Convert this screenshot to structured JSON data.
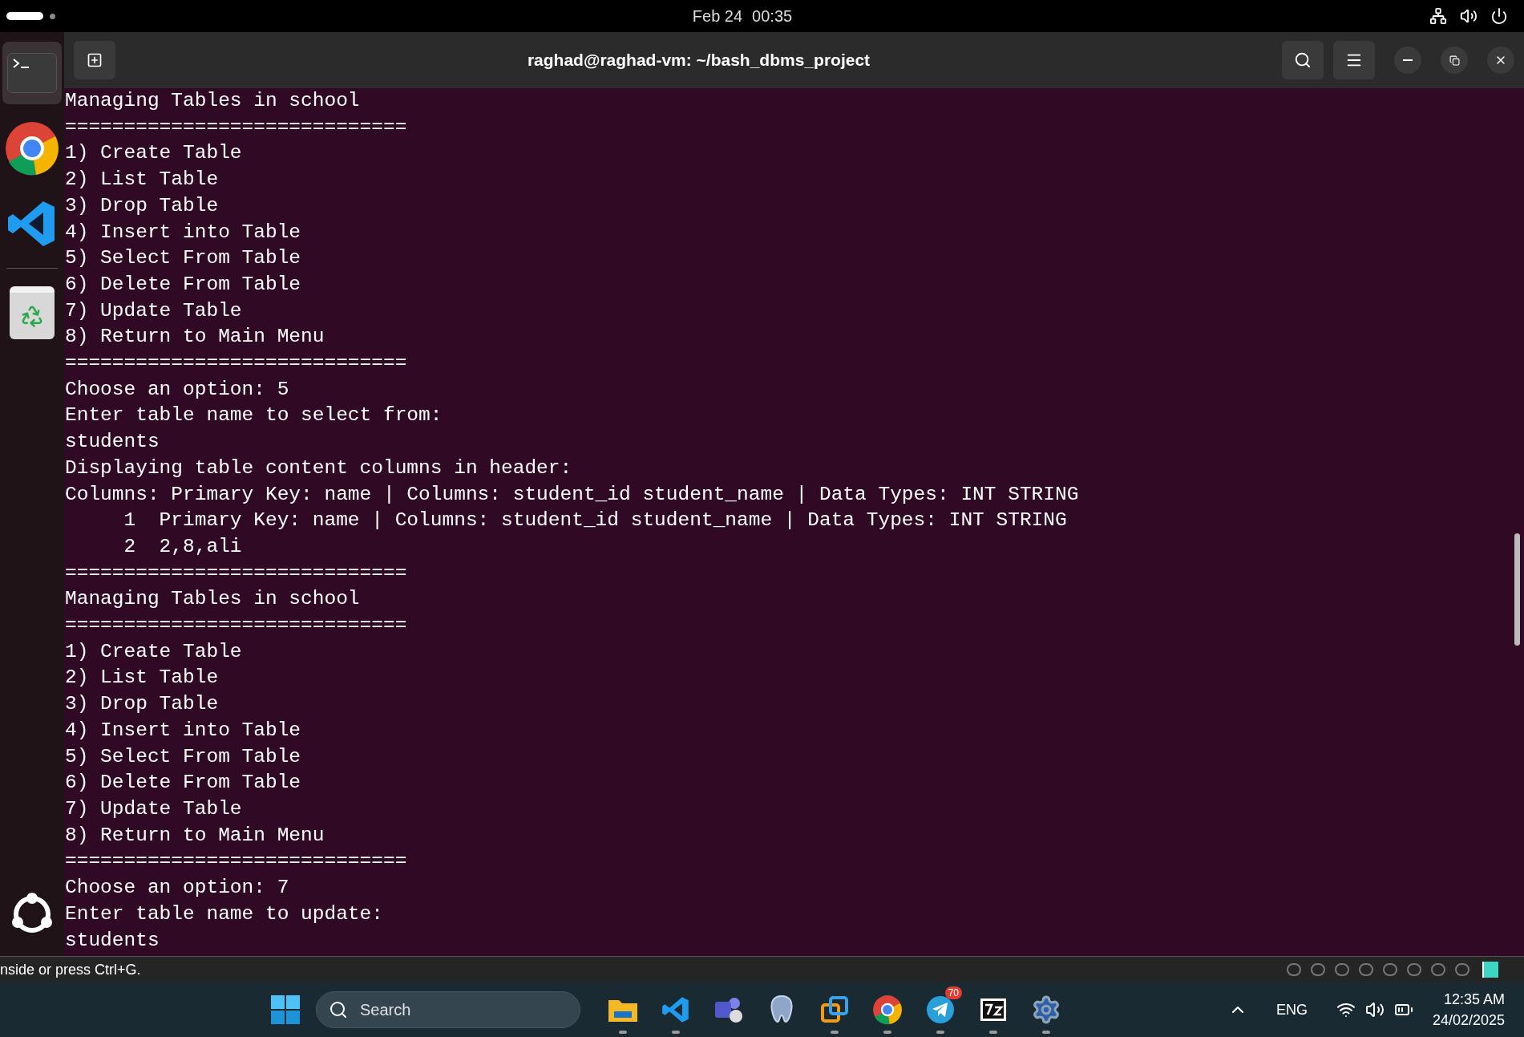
{
  "top_bar": {
    "date": "Feb 24",
    "time": "00:35"
  },
  "dock": {
    "items": [
      {
        "kind": "terminal",
        "selected": true
      },
      {
        "kind": "chrome",
        "selected": false
      },
      {
        "kind": "vscode",
        "selected": false
      },
      {
        "kind": "trash",
        "selected": false
      }
    ]
  },
  "terminal": {
    "title": "raghad@raghad-vm: ~/bash_dbms_project",
    "lines": [
      "Managing Tables in school",
      "=============================",
      "1) Create Table",
      "2) List Table",
      "3) Drop Table",
      "4) Insert into Table",
      "5) Select From Table",
      "6) Delete From Table",
      "7) Update Table",
      "8) Return to Main Menu",
      "=============================",
      "Choose an option: 5",
      "Enter table name to select from:",
      "students",
      "Displaying table content columns in header:",
      "Columns: Primary Key: name | Columns: student_id student_name | Data Types: INT STRING",
      "     1  Primary Key: name | Columns: student_id student_name | Data Types: INT STRING",
      "     2  2,8,ali",
      "=============================",
      "Managing Tables in school",
      "=============================",
      "1) Create Table",
      "2) List Table",
      "3) Drop Table",
      "4) Insert into Table",
      "5) Select From Table",
      "6) Delete From Table",
      "7) Update Table",
      "8) Return to Main Menu",
      "=============================",
      "Choose an option: 7",
      "Enter table name to update:",
      "students"
    ]
  },
  "vm_status_bar": {
    "hint": "nside or press Ctrl+G."
  },
  "taskbar": {
    "search": {
      "placeholder": "Search"
    },
    "apps": [
      {
        "kind": "files",
        "running": true
      },
      {
        "kind": "vscode",
        "running": true
      },
      {
        "kind": "teams",
        "running": false
      },
      {
        "kind": "postgres",
        "running": false
      },
      {
        "kind": "vmware",
        "running": true
      },
      {
        "kind": "chrome",
        "running": true
      },
      {
        "kind": "telegram",
        "running": true,
        "badge": "70"
      },
      {
        "kind": "archiver",
        "running": true
      },
      {
        "kind": "settings",
        "running": true
      }
    ],
    "language": "ENG",
    "clock": {
      "time": "12:35 AM",
      "date": "24/02/2025"
    }
  }
}
